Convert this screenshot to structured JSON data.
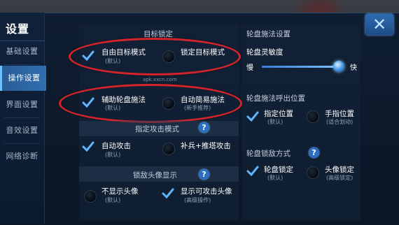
{
  "header": {
    "title": "设置",
    "close_icon": "close-x-icon"
  },
  "sidebar": {
    "items": [
      {
        "label": "基础设置",
        "active": false
      },
      {
        "label": "操作设置",
        "active": true
      },
      {
        "label": "界面设置",
        "active": false
      },
      {
        "label": "音效设置",
        "active": false
      },
      {
        "label": "网络诊断",
        "active": false
      }
    ]
  },
  "target_lock": {
    "title": "目标锁定",
    "options": [
      {
        "label": "自由目标模式",
        "sub": "(默认)",
        "checked": true
      },
      {
        "label": "锁定目标模式",
        "sub": "",
        "checked": false
      }
    ]
  },
  "wheel_cast": {
    "options": [
      {
        "label": "辅助轮盘施法",
        "sub": "(默认)",
        "checked": true
      },
      {
        "label": "自动简易施法",
        "sub": "(新手推荐)",
        "checked": false
      }
    ]
  },
  "watermark": "apk.xxcn.com",
  "attack_mode": {
    "title": "指定攻击模式",
    "options": [
      {
        "label": "自动攻击",
        "sub": "(默认)",
        "checked": true
      },
      {
        "label": "补兵+推塔攻击",
        "sub": "",
        "checked": false
      }
    ]
  },
  "lock_avatar": {
    "title": "锁敌头像显示",
    "options": [
      {
        "label": "不显示头像",
        "sub": "(默认)",
        "checked": false
      },
      {
        "label": "显示可攻击头像",
        "sub": "(高级操作)",
        "checked": true
      }
    ]
  },
  "wheel_settings": {
    "title": "轮盘施法设置",
    "sensitivity_label": "轮盘灵敏度",
    "slow": "慢",
    "fast": "快",
    "sensitivity_value": 0.93
  },
  "wheel_callout": {
    "title": "轮盘施法呼出位置",
    "options": [
      {
        "label": "指定位置",
        "sub": "(默认)",
        "checked": true
      },
      {
        "label": "手指位置",
        "sub": "(适合划动)",
        "checked": false
      }
    ]
  },
  "lock_method": {
    "title": "轮盘锁敌方式",
    "options": [
      {
        "label": "轮盘锁定",
        "sub": "(默认)",
        "checked": true
      },
      {
        "label": "头像锁定",
        "sub": "(高级锁定)",
        "checked": false
      }
    ]
  },
  "colors": {
    "accent": "#2f6fb0",
    "highlight_oval": "#d3232b",
    "check": "#5fb6ff"
  }
}
